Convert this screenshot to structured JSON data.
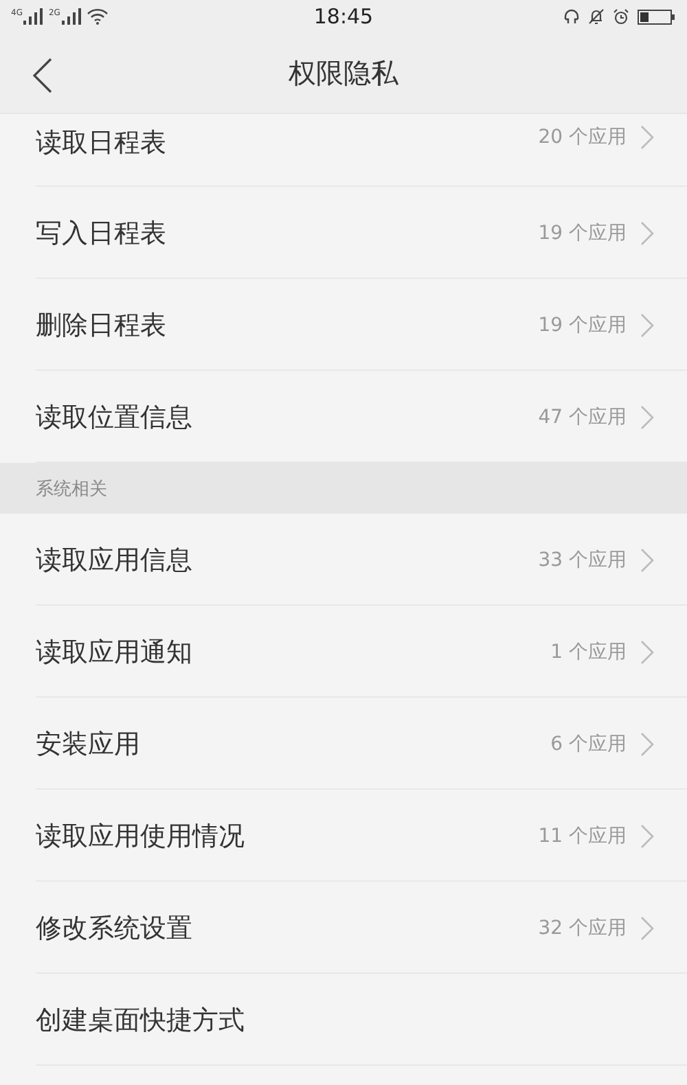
{
  "status_bar": {
    "time": "18:45",
    "signals": [
      {
        "label": "4G"
      },
      {
        "label": "2G"
      }
    ]
  },
  "header": {
    "title": "权限隐私"
  },
  "sections": [
    {
      "items": [
        {
          "label": "读取日程表",
          "count": "20 个应用"
        },
        {
          "label": "写入日程表",
          "count": "19 个应用"
        },
        {
          "label": "删除日程表",
          "count": "19 个应用"
        },
        {
          "label": "读取位置信息",
          "count": "47 个应用"
        }
      ]
    },
    {
      "title": "系统相关",
      "items": [
        {
          "label": "读取应用信息",
          "count": "33 个应用"
        },
        {
          "label": "读取应用通知",
          "count": "1 个应用"
        },
        {
          "label": "安装应用",
          "count": "6 个应用"
        },
        {
          "label": "读取应用使用情况",
          "count": "11 个应用"
        },
        {
          "label": "修改系统设置",
          "count": "32 个应用"
        },
        {
          "label": "创建桌面快捷方式"
        }
      ]
    }
  ]
}
